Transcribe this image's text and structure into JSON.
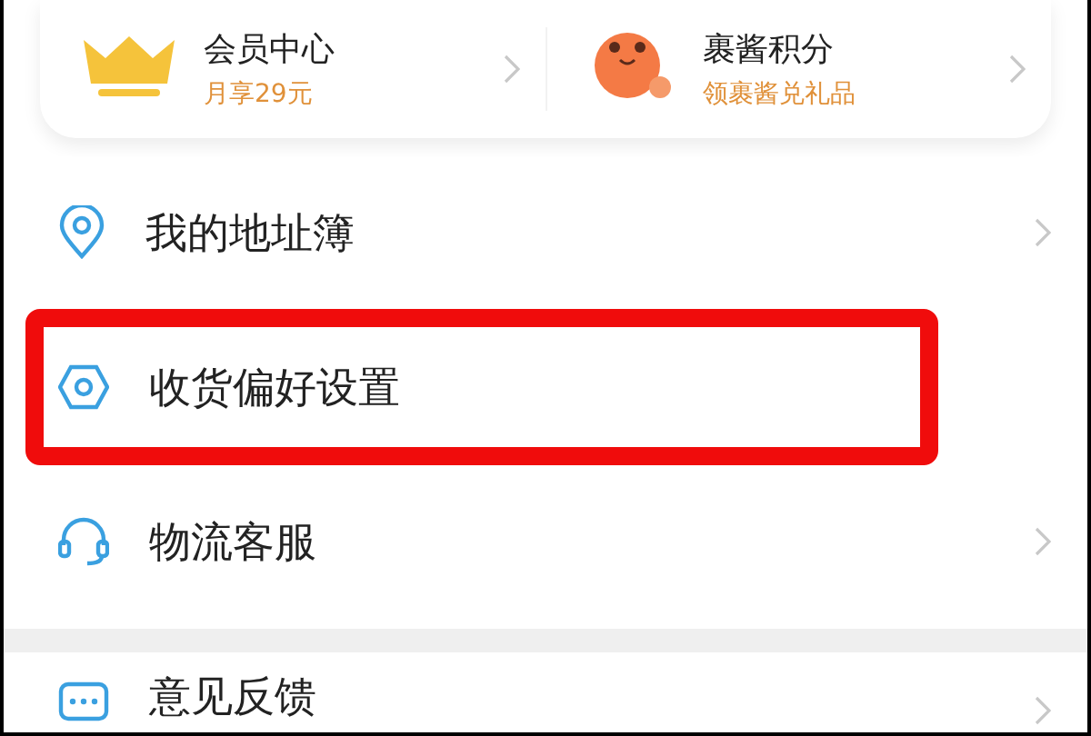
{
  "top_cards": [
    {
      "kind": "crown",
      "title": "会员中心",
      "subtitle": "月享29元"
    },
    {
      "kind": "mascot",
      "title": "裹酱积分",
      "subtitle": "领裹酱兑礼品"
    }
  ],
  "menu": [
    {
      "kind": "pin",
      "label": "我的地址簿",
      "selected": false
    },
    {
      "kind": "hexagon",
      "label": "收货偏好设置",
      "selected": true
    },
    {
      "kind": "headset",
      "label": "物流客服",
      "selected": false
    }
  ],
  "menu_2": [
    {
      "kind": "chat",
      "label": "意见反馈",
      "selected": false
    }
  ]
}
